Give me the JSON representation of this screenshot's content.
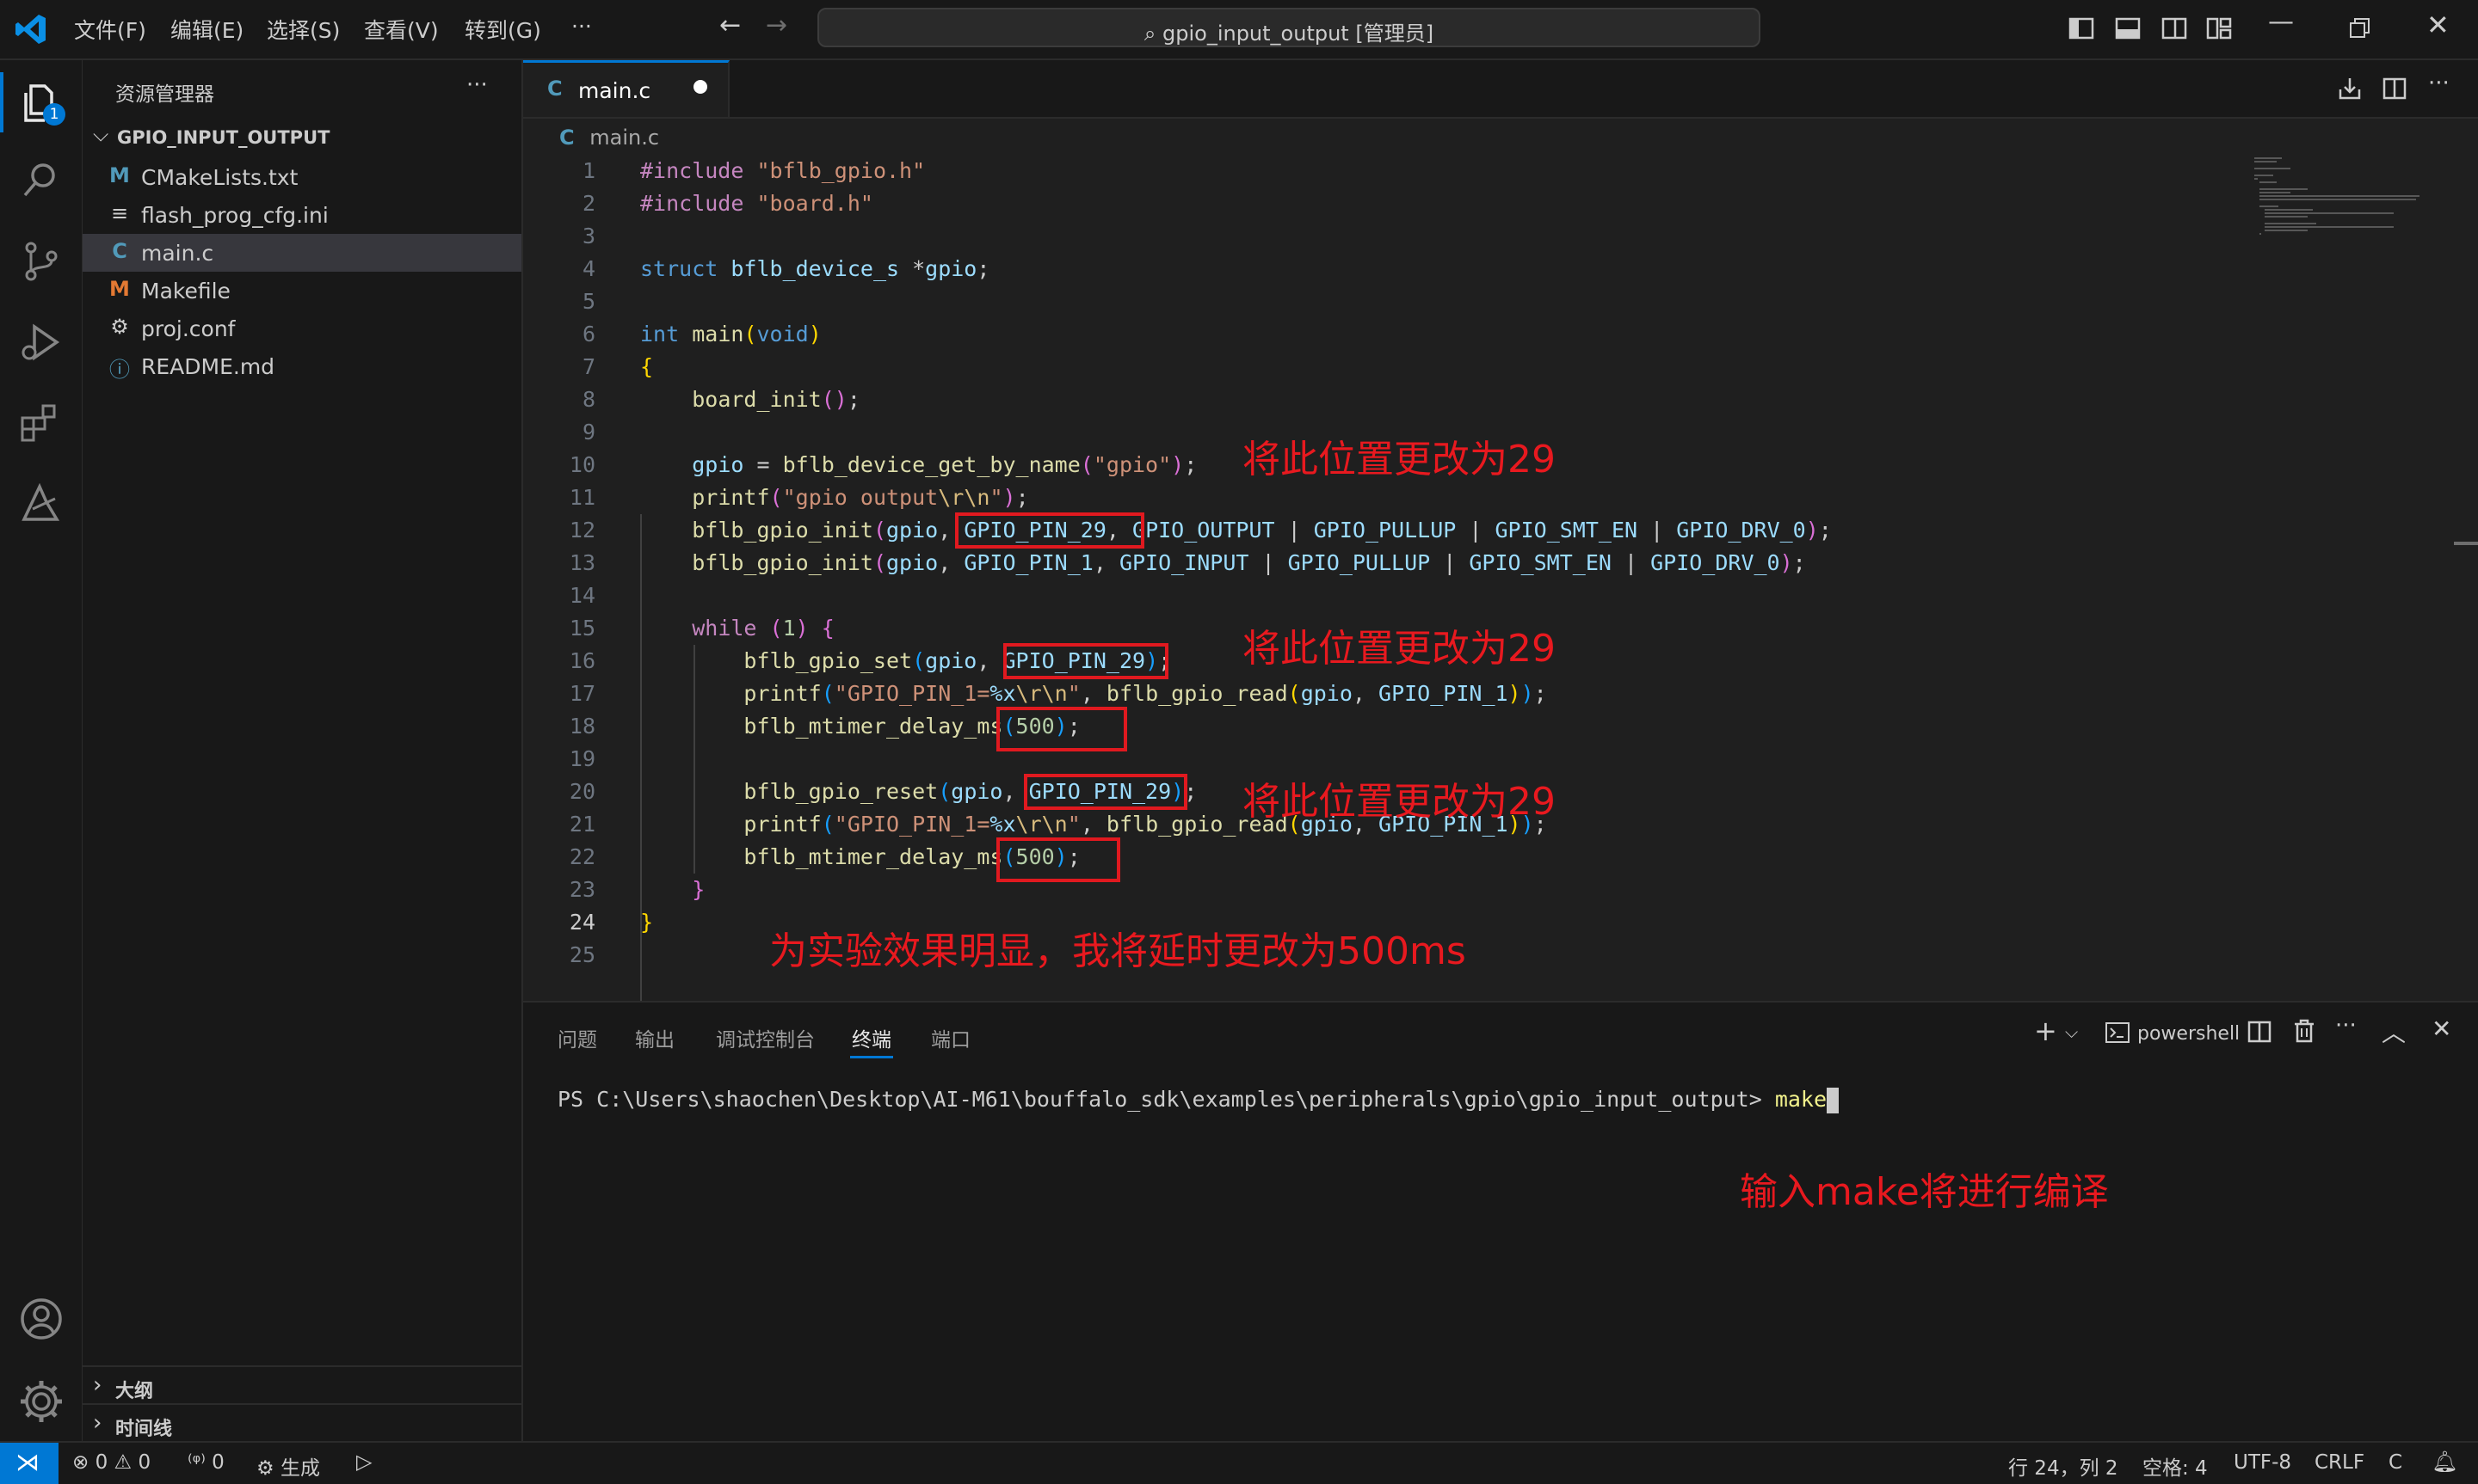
{
  "titlebar": {
    "menus": [
      "文件(F)",
      "编辑(E)",
      "选择(S)",
      "查看(V)",
      "转到(G)",
      "···"
    ],
    "search_text": "gpio_input_output [管理员]"
  },
  "activitybar": {
    "explorer_badge": "1"
  },
  "sidebar": {
    "title": "资源管理器",
    "more": "···",
    "folder": "GPIO_INPUT_OUTPUT",
    "files": [
      {
        "icon": "M",
        "name": "CMakeLists.txt",
        "color": "#519aba"
      },
      {
        "icon": "≡",
        "name": "flash_prog_cfg.ini",
        "color": "#cccccc"
      },
      {
        "icon": "C",
        "name": "main.c",
        "color": "#519aba"
      },
      {
        "icon": "M",
        "name": "Makefile",
        "color": "#e37933"
      },
      {
        "icon": "⚙",
        "name": "proj.conf",
        "color": "#cccccc"
      },
      {
        "icon": "ⓘ",
        "name": "README.md",
        "color": "#519aba"
      }
    ],
    "sections": [
      "大纲",
      "时间线"
    ]
  },
  "editor": {
    "tab_icon": "C",
    "tab_label": "main.c",
    "breadcrumb": "main.c",
    "active_line": 24,
    "line_numbers": [
      "1",
      "2",
      "3",
      "4",
      "5",
      "6",
      "7",
      "8",
      "9",
      "10",
      "11",
      "12",
      "13",
      "14",
      "15",
      "16",
      "17",
      "18",
      "19",
      "20",
      "21",
      "22",
      "23",
      "24",
      "25"
    ]
  },
  "annotations": {
    "a1": "将此位置更改为29",
    "a2": "将此位置更改为29",
    "a3": "将此位置更改为29",
    "a4": "为实验效果明显，我将延时更改为500ms",
    "a5": "输入make将进行编译"
  },
  "panel": {
    "tabs": [
      "问题",
      "输出",
      "调试控制台",
      "终端",
      "端口"
    ],
    "active_tab": "终端",
    "shell": "powershell",
    "terminal_prompt": "PS C:\\Users\\shaochen\\Desktop\\AI-M61\\bouffalo_sdk\\examples\\peripherals\\gpio\\gpio_input_output> ",
    "terminal_command": "make"
  },
  "statusbar": {
    "errors": "0",
    "warnings": "0",
    "ports": "0",
    "build": "生成",
    "cursor": "行 24，列 2",
    "indent": "空格: 4",
    "encoding": "UTF-8",
    "eol": "CRLF",
    "language": "C"
  },
  "colors": {
    "accent": "#0078d4",
    "annotation": "#e8191f",
    "remote": "#0078d4"
  }
}
